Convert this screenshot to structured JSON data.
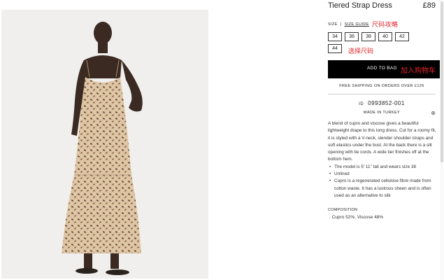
{
  "product": {
    "name": "Tiered Strap Dress",
    "price": "£89"
  },
  "size_section": {
    "label": "SIZE",
    "separator": "|",
    "guide_link": "SIZE GUIDE",
    "guide_annotation": "尺码攻略",
    "sizes": [
      "34",
      "36",
      "38",
      "40",
      "42",
      "44"
    ],
    "select_annotation": "选择尺码"
  },
  "add_to_bag": {
    "label": "ADD TO BAG",
    "annotation": "加入购物车"
  },
  "shipping_note": "FREE SHIPPING ON ORDERS OVER £125",
  "article": {
    "id_label": "ID",
    "id_value": "0993852-001",
    "made_in": "MADE IN TURKEY",
    "info_icon": "info-icon"
  },
  "description": {
    "paragraph": "A blend of cupro and viscose gives a beautiful lightweight drape to this long dress. Cut for a roomy fit, it is styled with a V-neck, slender shoulder straps and soft elastics under the bust. At the back there is a slit opening with tie cords. A wide tier finishes off at the bottom hem.",
    "bullets": [
      "The model is 5' 11\" tall and wears size 38",
      "Unlined",
      "Cupro is a regenerated cellulose fibre made from cotton waste. It has a lustrous sheen and is often used as an alternative to silk"
    ]
  },
  "composition": {
    "label": "COMPOSITION",
    "value": ": Cupro 52%, Viscose 48%"
  },
  "colors": {
    "annotation_red": "#e0242a",
    "button_black": "#000000",
    "dress_beige": "#d9bd9b",
    "dress_print": "#5a3c28"
  }
}
